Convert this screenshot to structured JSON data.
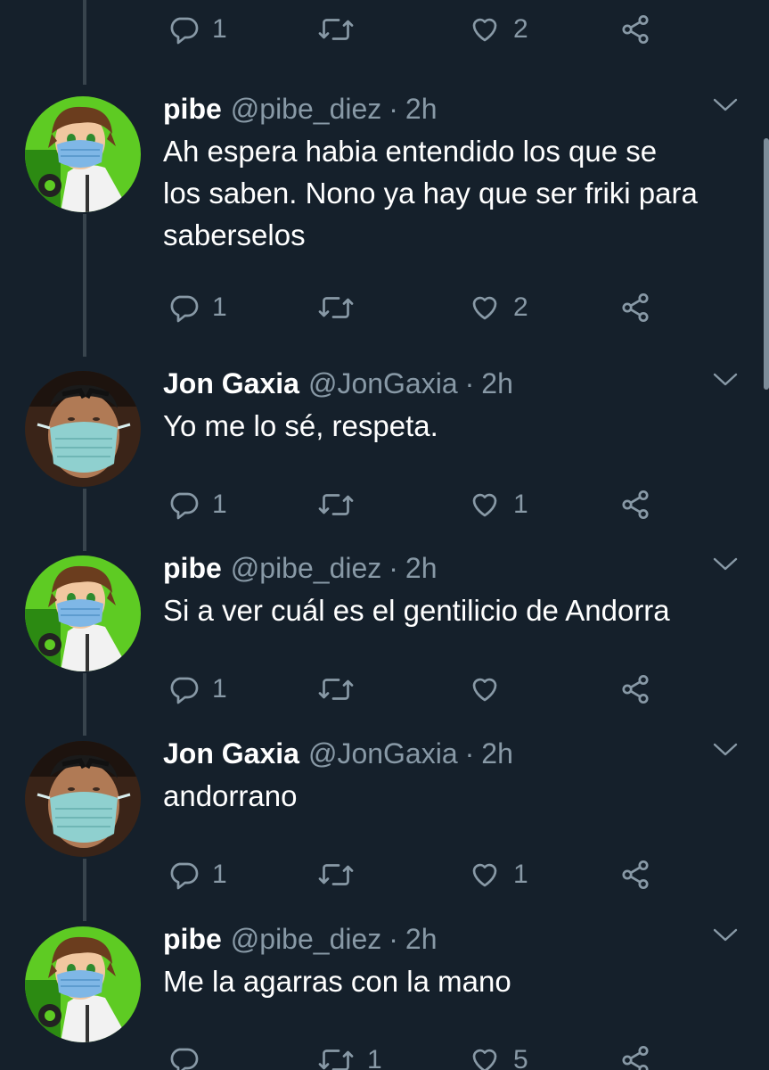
{
  "top_actions": {
    "reply_count": "1",
    "retweet_count": "",
    "like_count": "2"
  },
  "tweets": [
    {
      "name": "pibe",
      "handle": "@pibe_diez",
      "separator": "·",
      "time": "2h",
      "lines": [
        "Ah espera habia entendido los que se",
        "los saben. Nono ya hay que ser friki para",
        "saberselos"
      ],
      "reply_count": "1",
      "retweet_count": "",
      "like_count": "2",
      "avatar": "pibe"
    },
    {
      "name": "Jon Gaxia",
      "handle": "@JonGaxia",
      "separator": "·",
      "time": "2h",
      "lines": [
        "Yo me lo sé, respeta."
      ],
      "reply_count": "1",
      "retweet_count": "",
      "like_count": "1",
      "avatar": "jon"
    },
    {
      "name": "pibe",
      "handle": "@pibe_diez",
      "separator": "·",
      "time": "2h",
      "lines": [
        "Si a ver cuál es el gentilicio de Andorra"
      ],
      "reply_count": "1",
      "retweet_count": "",
      "like_count": "",
      "avatar": "pibe"
    },
    {
      "name": "Jon Gaxia",
      "handle": "@JonGaxia",
      "separator": "·",
      "time": "2h",
      "lines": [
        "andorrano"
      ],
      "reply_count": "1",
      "retweet_count": "",
      "like_count": "1",
      "avatar": "jon"
    },
    {
      "name": "pibe",
      "handle": "@pibe_diez",
      "separator": "·",
      "time": "2h",
      "lines": [
        "Me la agarras con la mano"
      ],
      "reply_count": "",
      "retweet_count": "1",
      "like_count": "5",
      "avatar": "pibe"
    }
  ],
  "colors": {
    "background": "#15202b",
    "secondary_text": "#8899a6",
    "thread_line": "#38444d"
  }
}
